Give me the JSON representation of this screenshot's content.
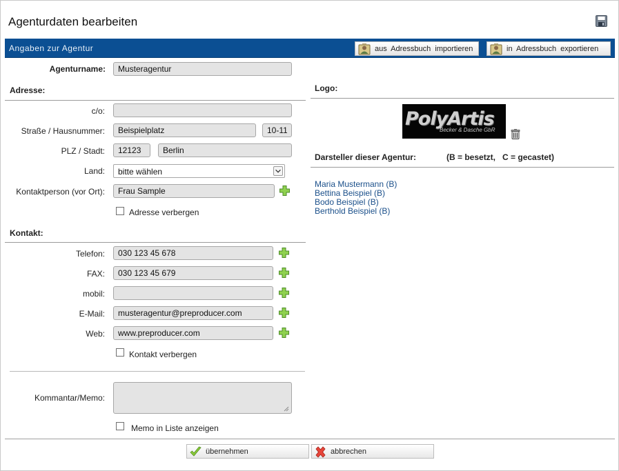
{
  "page": {
    "title": "Agenturdaten bearbeiten"
  },
  "section_bar": {
    "label": "Angaben zur Agentur",
    "import_label": "aus Adressbuch importieren",
    "export_label": "in Adressbuch exportieren"
  },
  "agency": {
    "name_label": "Agenturname:",
    "name_value": "Musteragentur"
  },
  "address": {
    "heading": "Adresse:",
    "co_label": "c/o:",
    "co_value": "",
    "street_label": "Straße / Hausnummer:",
    "street_value": "Beispielplatz",
    "number_value": "10-11",
    "zip_city_label": "PLZ / Stadt:",
    "zip_value": "12123",
    "city_value": "Berlin",
    "country_label": "Land:",
    "country_value": "bitte wählen",
    "contact_label": "Kontaktperson (vor Ort):",
    "contact_value": "Frau Sample",
    "hide_label": "Adresse verbergen"
  },
  "contact": {
    "heading": "Kontakt:",
    "phone_label": "Telefon:",
    "phone_value": "030 123 45 678",
    "fax_label": "FAX:",
    "fax_value": "030 123 45 679",
    "mobile_label": "mobil:",
    "mobile_value": "",
    "email_label": "E-Mail:",
    "email_value": "musteragentur@preproducer.com",
    "web_label": "Web:",
    "web_value": "www.preproducer.com",
    "hide_label": "Kontakt verbergen"
  },
  "memo": {
    "label": "Kommantar/Memo:",
    "value": "",
    "show_label": "Memo in Liste anzeigen"
  },
  "logo": {
    "heading": "Logo:",
    "brand": "PolyArtis",
    "sub": "Becker & Dasche GbR"
  },
  "actors": {
    "heading": "Darsteller dieser Agentur:",
    "note": "(B = besetzt,   C = gecastet)",
    "items": [
      "Maria Mustermann  (B)",
      "Bettina Beispiel  (B)",
      "Bodo Beispiel  (B)",
      "Berthold Beispiel  (B)"
    ]
  },
  "footer": {
    "ok_label": "übernehmen",
    "cancel_label": "abbrechen"
  },
  "colors": {
    "bar": "#0b4f93",
    "link": "#1a4f8a",
    "field_bg": "#e4e4e4"
  }
}
